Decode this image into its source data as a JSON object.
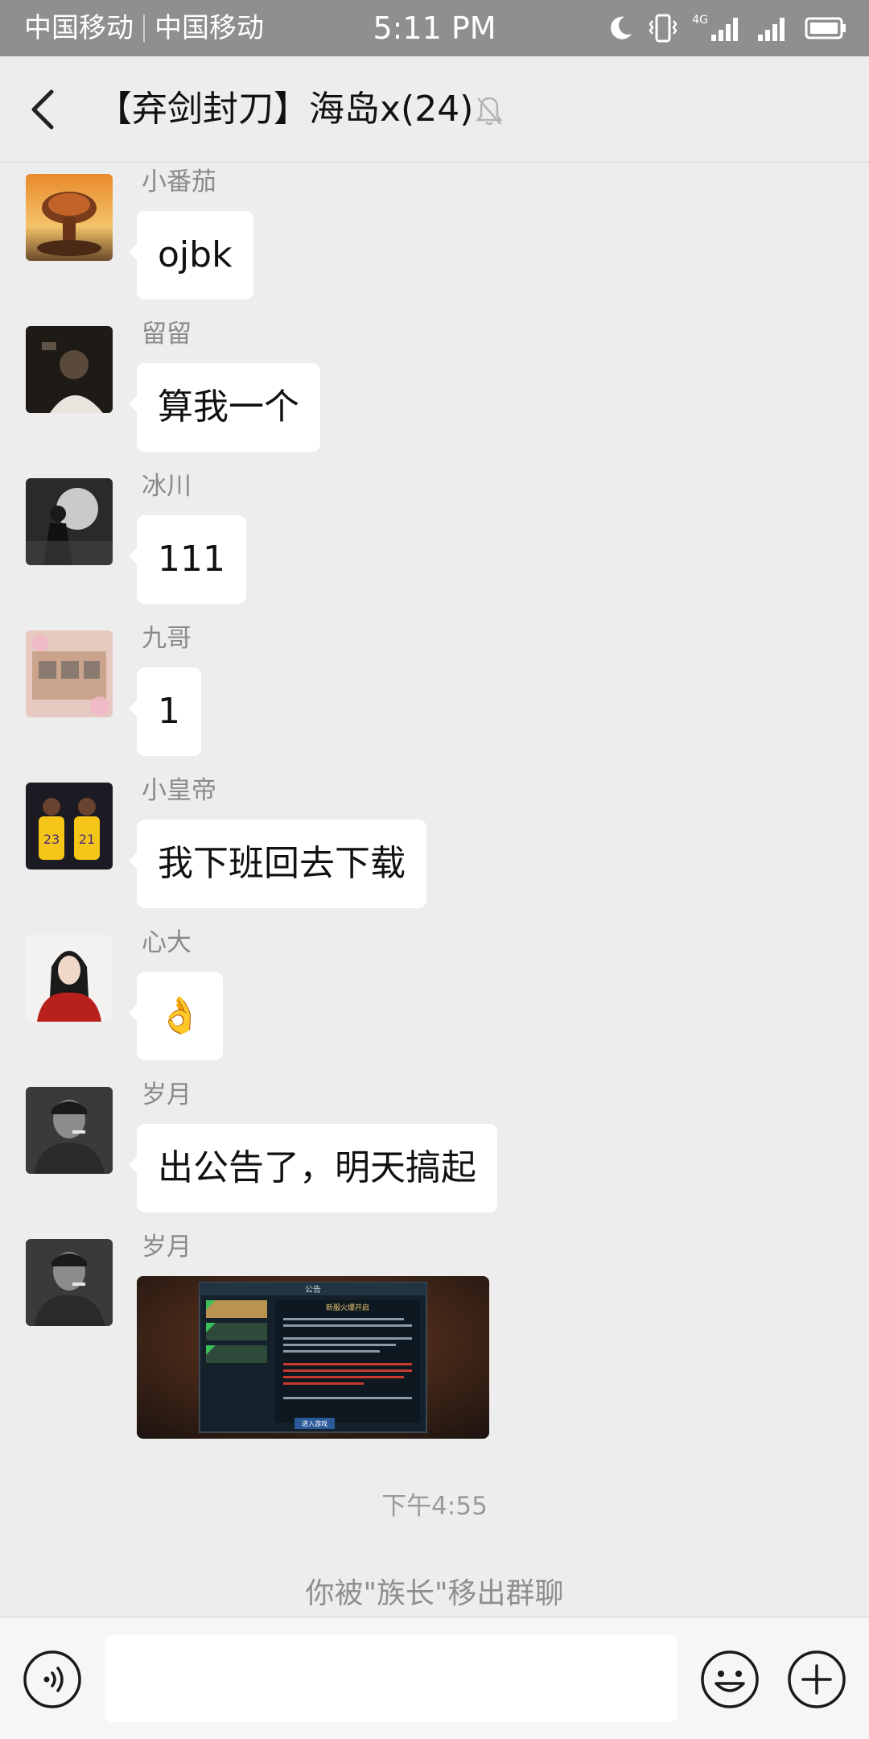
{
  "status_bar": {
    "carrier1": "中国移动",
    "carrier2": "中国移动",
    "time": "5:11 PM",
    "network": "4G"
  },
  "header": {
    "title": "【弃剑封刀】海岛x(24)"
  },
  "messages": [
    {
      "sender": "小番茄",
      "text": "ojbk"
    },
    {
      "sender": "留留",
      "text": "算我一个"
    },
    {
      "sender": "冰川",
      "text": "111"
    },
    {
      "sender": "九哥",
      "text": "1"
    },
    {
      "sender": "小皇帝",
      "text": "我下班回去下载"
    },
    {
      "sender": "心大",
      "text": "👌"
    },
    {
      "sender": "岁月",
      "text": "出公告了，明天搞起"
    },
    {
      "sender": "岁月",
      "image": {
        "panel_title": "公告",
        "notice_title": "新服火爆开启",
        "tabs": [
          "",
          "",
          ""
        ],
        "button": "进入游戏"
      }
    }
  ],
  "time_label": "下午4:55",
  "system_note": "你被\"族长\"移出群聊",
  "input": {
    "placeholder": ""
  },
  "colors": {
    "background": "#ededed",
    "bubble": "#ffffff",
    "status_bar": "#8f8f8f"
  }
}
